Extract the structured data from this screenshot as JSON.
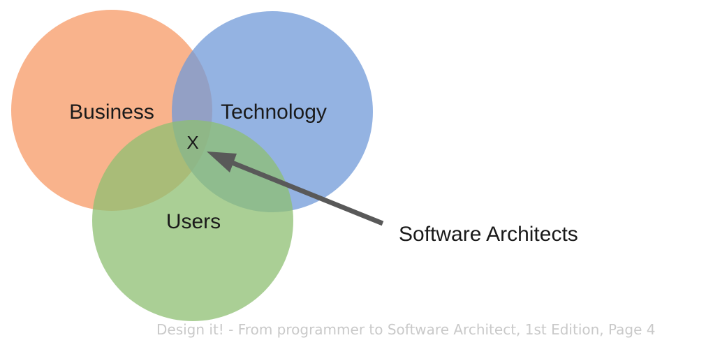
{
  "diagram": {
    "sets": [
      {
        "id": "business",
        "label": "Business",
        "color": "#f79a66"
      },
      {
        "id": "technology",
        "label": "Technology",
        "color": "#7099d8"
      },
      {
        "id": "users",
        "label": "Users",
        "color": "#8dbf72"
      }
    ],
    "intersection_marker": "X",
    "arrow_label": "Software Architects",
    "arrow_color": "#595959"
  },
  "caption": "Design it! - From programmer to Software Architect, 1st Edition, Page 4"
}
